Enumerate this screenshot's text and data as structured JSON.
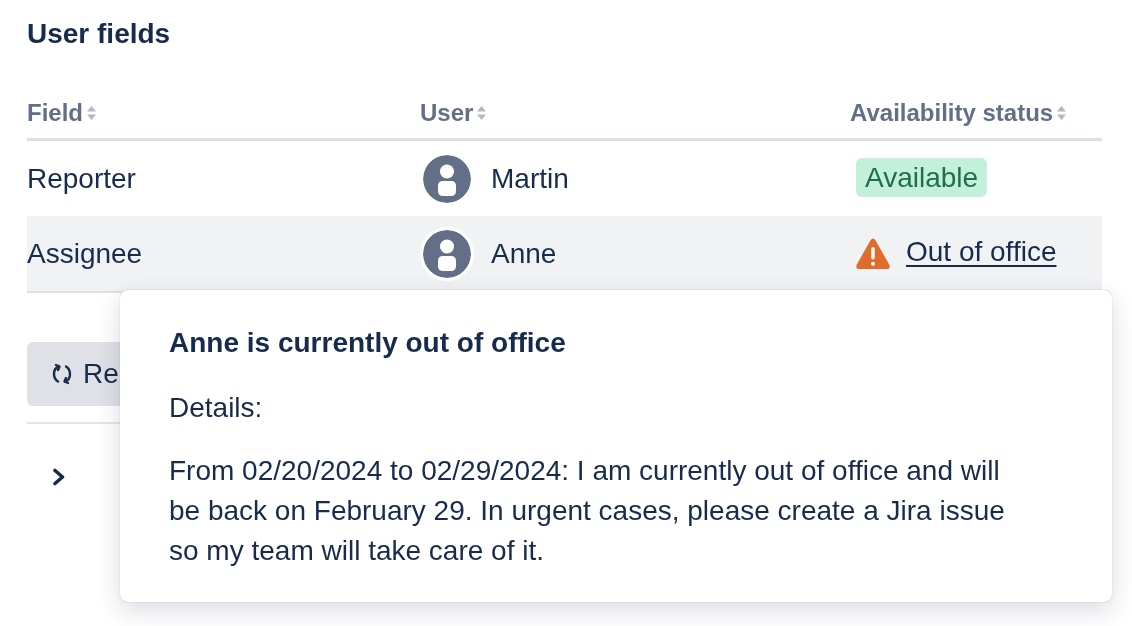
{
  "section_title": "User fields",
  "table": {
    "columns": [
      {
        "label": "Field",
        "sortable": true
      },
      {
        "label": "User",
        "sortable": true
      },
      {
        "label": "Availability status",
        "sortable": true
      }
    ],
    "rows": [
      {
        "field": "Reporter",
        "user": "Martin",
        "highlighted": false,
        "status": {
          "kind": "badge",
          "label": "Available"
        }
      },
      {
        "field": "Assignee",
        "user": "Anne",
        "highlighted": true,
        "status": {
          "kind": "warning_link",
          "label": "Out of office"
        }
      }
    ]
  },
  "refresh_button": {
    "label": "Re"
  },
  "expander": {
    "expanded": false
  },
  "popover": {
    "title": "Anne is currently out of office",
    "details_label": "Details:",
    "text": "From 02/20/2024 to 02/29/2024: I am currently out of office and will be back on February 29. In urgent cases, please create a Jira issue so my team will take care of it."
  }
}
